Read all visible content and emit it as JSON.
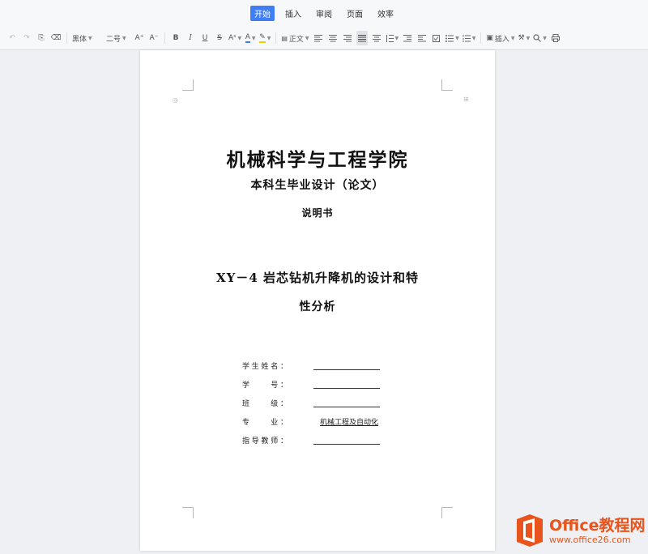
{
  "menu": {
    "tabs": [
      {
        "label": "开始",
        "active": true
      },
      {
        "label": "插入",
        "active": false
      },
      {
        "label": "审阅",
        "active": false
      },
      {
        "label": "页面",
        "active": false
      },
      {
        "label": "效率",
        "active": false
      }
    ]
  },
  "toolbar": {
    "undo_glyph": "↶",
    "redo_glyph": "↷",
    "format_painter_glyph": "⎘",
    "eraser_glyph": "⌫",
    "font_name": "黑体",
    "font_size": "二号",
    "grow_font": "A⁺",
    "shrink_font": "A⁻",
    "bold": "B",
    "italic": "I",
    "underline": "U",
    "strikethrough": "S",
    "superscript": "Aˢ",
    "font_color": "A",
    "highlight_glyph": "✎",
    "style_name": "正文",
    "insert_label": "插入",
    "accent_color": "#3f7ef7"
  },
  "document": {
    "school": "机械科学与工程学院",
    "subtitle": "本科生毕业设计（论文）",
    "description": "说明书",
    "title_line1": "XY－4 岩芯钻机升降机的设计和特",
    "title_line2": "性分析",
    "fields": [
      {
        "label": "学生姓名：",
        "value": ""
      },
      {
        "label": "学　　号：",
        "value": ""
      },
      {
        "label": "班　　级：",
        "value": ""
      },
      {
        "label": "专　　业：",
        "value": "机械工程及自动化"
      },
      {
        "label": "指导教师：",
        "value": ""
      }
    ]
  },
  "watermark": {
    "brand": "Office教程网",
    "url": "www.office26.com",
    "color": "#e9541c"
  }
}
